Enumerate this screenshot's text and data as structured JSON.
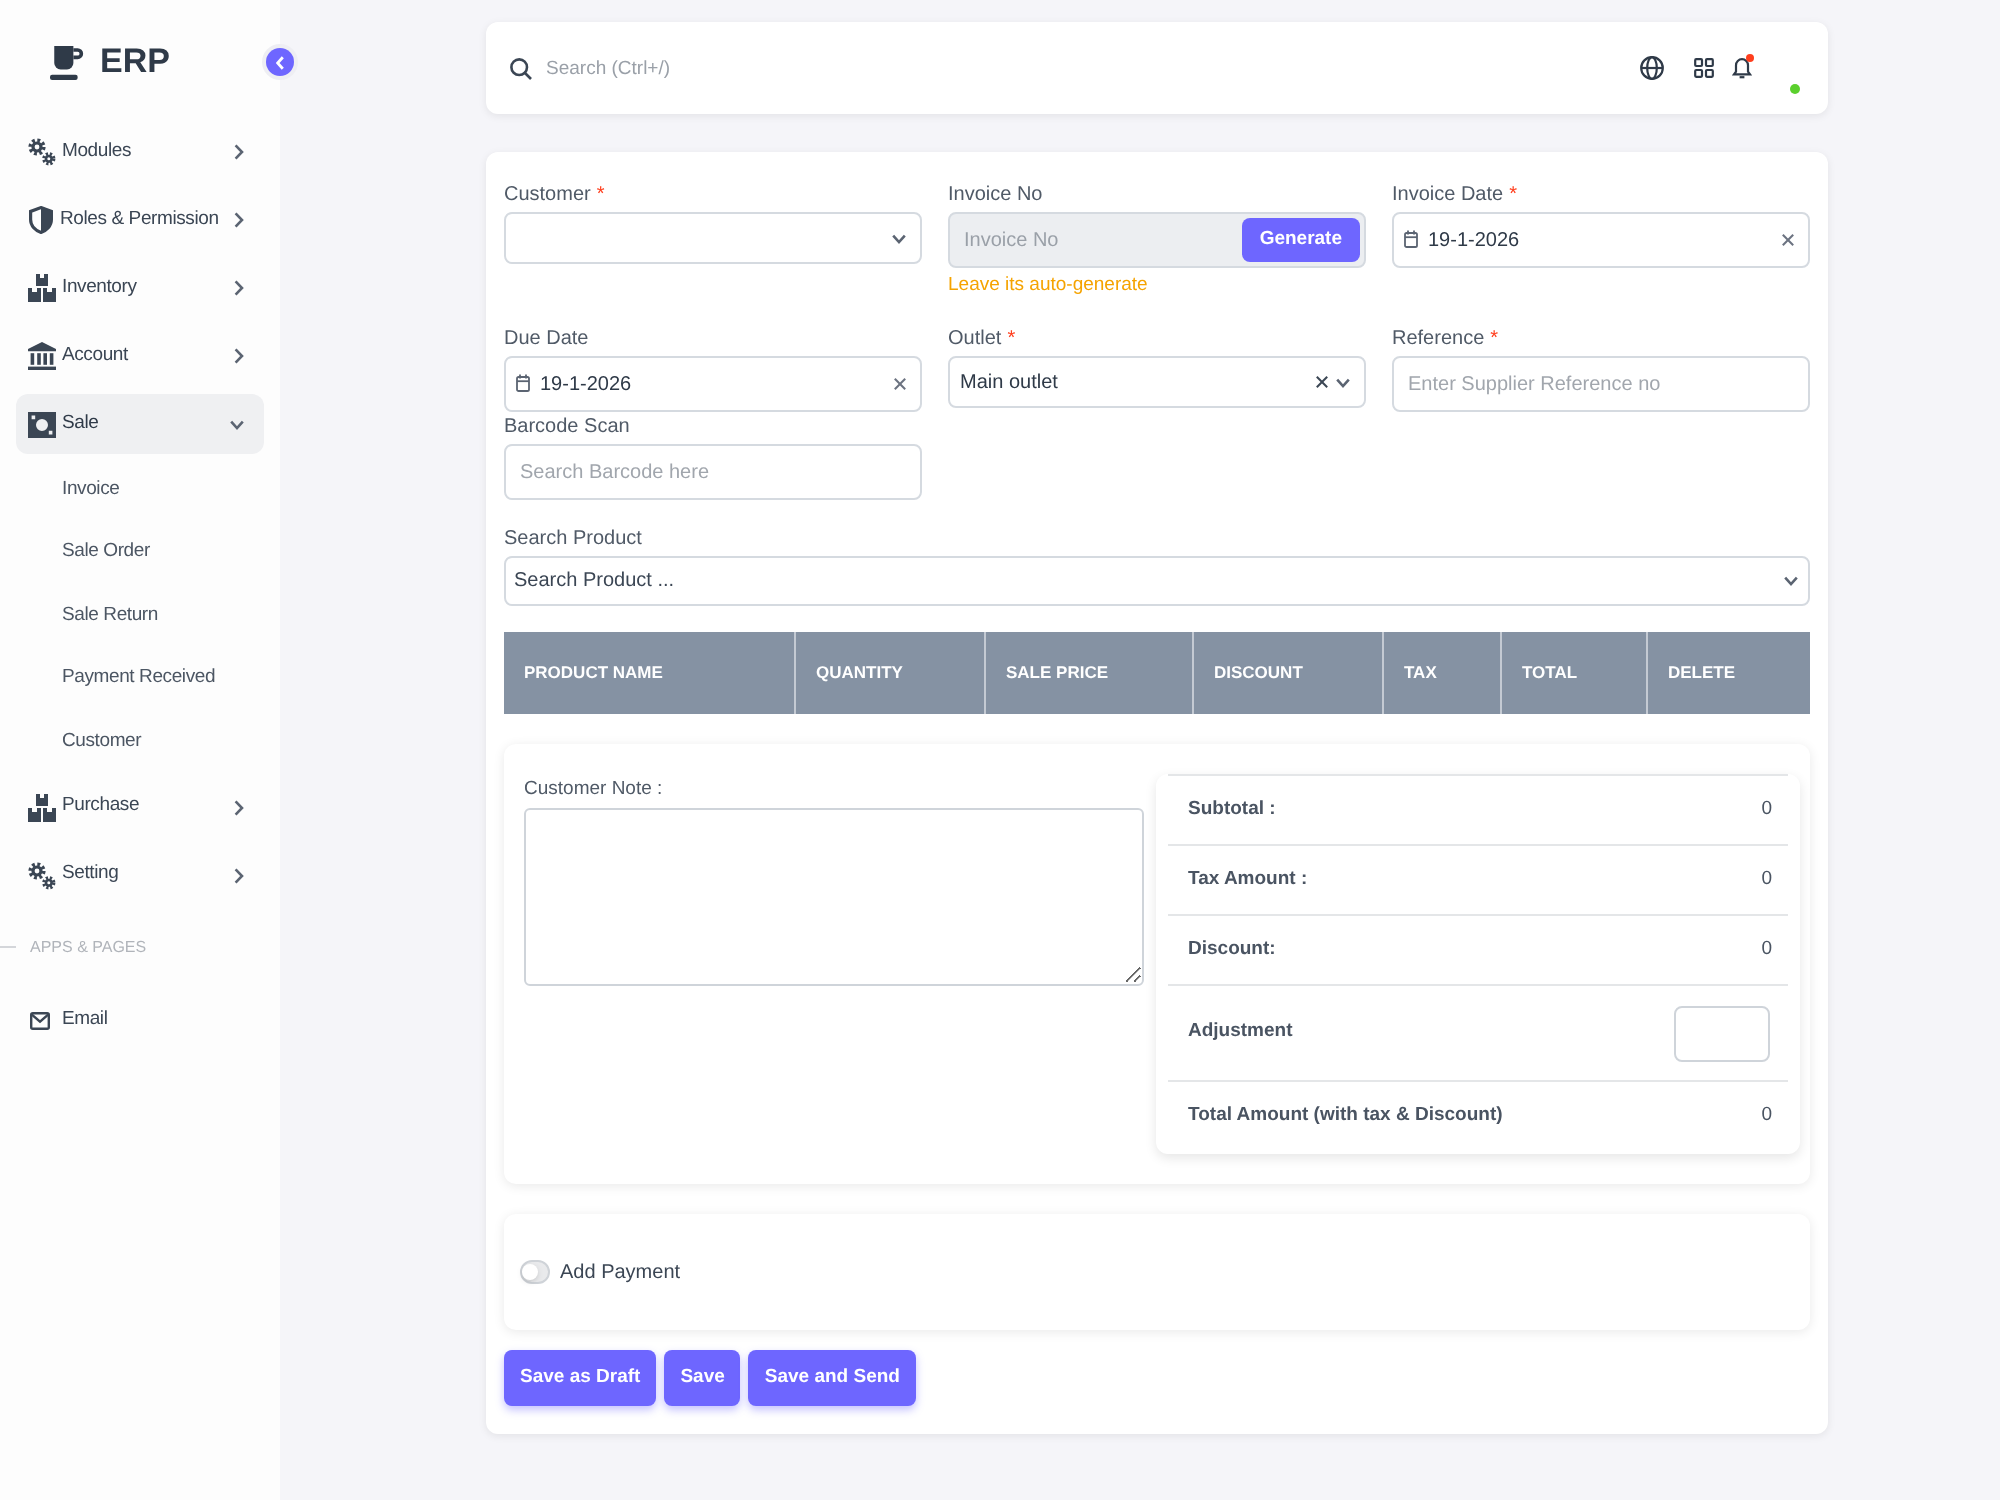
{
  "sidebar": {
    "brand": "ERP",
    "menu": [
      {
        "label": "Modules",
        "selected": false,
        "expanded": false
      },
      {
        "label": "Roles & Permission",
        "selected": false,
        "expanded": false
      },
      {
        "label": "Inventory",
        "selected": false,
        "expanded": false
      },
      {
        "label": "Account",
        "selected": false,
        "expanded": false
      },
      {
        "label": "Sale",
        "selected": true,
        "expanded": true,
        "children": [
          {
            "label": "Invoice",
            "selected": false
          },
          {
            "label": "Sale Order",
            "selected": false
          },
          {
            "label": "Sale Return",
            "selected": false
          },
          {
            "label": "Payment Received",
            "selected": false
          },
          {
            "label": "Customer",
            "selected": false
          }
        ]
      },
      {
        "label": "Purchase",
        "selected": false,
        "expanded": false
      },
      {
        "label": "Setting",
        "selected": false,
        "expanded": false
      }
    ],
    "sections": [
      {
        "title": "APPS & PAGES",
        "items": [
          {
            "label": "Email",
            "selected": false
          }
        ]
      }
    ]
  },
  "topbar": {
    "search": {
      "placeholder": "Search (Ctrl+/)"
    }
  },
  "form": {
    "fields": [
      {
        "label": "Customer",
        "required_mark": "*",
        "kind": "select"
      },
      {
        "label": "Invoice No",
        "kind": "generate",
        "placeholder": "Invoice No",
        "button": "Generate",
        "hint": "Leave its auto-generate"
      },
      {
        "label": "Invoice Date",
        "required_mark": "*",
        "kind": "date",
        "value": "19-1-2026"
      },
      {
        "label": "Due Date",
        "kind": "date",
        "value": "19-1-2026"
      },
      {
        "label": "Outlet",
        "required_mark": "*",
        "kind": "select",
        "value": "Main outlet"
      },
      {
        "label": "Reference",
        "required_mark": "*",
        "kind": "text",
        "placeholder": "Enter Supplier Reference no"
      },
      {
        "label": "Barcode Scan",
        "kind": "text",
        "placeholder": "Search Barcode here"
      }
    ],
    "product_search": {
      "label": "Search Product",
      "placeholder": "Search Product ..."
    },
    "table": {
      "columns": [
        "PRODUCT NAME",
        "QUANTITY",
        "SALE PRICE",
        "DISCOUNT",
        "TAX",
        "TOTAL",
        "DELETE"
      ]
    },
    "note": {
      "label": "Customer Note :"
    },
    "summary": [
      {
        "kind": "amount",
        "label": "Subtotal :",
        "value": "0"
      },
      {
        "kind": "amount",
        "label": "Tax Amount :",
        "value": "0"
      },
      {
        "kind": "amount",
        "label": "Discount:",
        "value": "0"
      },
      {
        "kind": "input",
        "label": "Adjustment"
      },
      {
        "kind": "amount",
        "label": "Total Amount (with tax & Discount)",
        "value": "0"
      }
    ]
  },
  "payment": {
    "label": "Add Payment",
    "on": false
  },
  "buttons": [
    "Save as Draft",
    "Save",
    "Save and Send"
  ]
}
